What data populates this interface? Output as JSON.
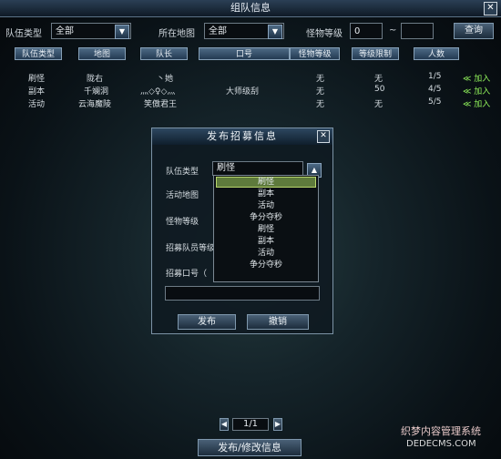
{
  "window": {
    "title": "组队信息",
    "close": "✕"
  },
  "filters": {
    "type_label": "队伍类型",
    "type_value": "全部",
    "map_label": "所在地图",
    "map_value": "全部",
    "level_label": "怪物等级",
    "level_min": "0",
    "level_sep": "~",
    "level_max": "",
    "search_button": "查询"
  },
  "columns": [
    "队伍类型",
    "地图",
    "队长",
    "口号",
    "怪物等级",
    "等级限制",
    "人数"
  ],
  "rows": [
    {
      "type": "刷怪",
      "map": "陇右",
      "leader": "丶她",
      "slogan": "",
      "monster_level": "无",
      "level_limit": "无",
      "count": "1/5",
      "join": "≪ 加入"
    },
    {
      "type": "副本",
      "map": "千斓洞",
      "leader": "灬◇♀◇灬",
      "slogan": "大师级刮",
      "monster_level": "无",
      "level_limit": "50",
      "count": "4/5",
      "join": "≪ 加入"
    },
    {
      "type": "活动",
      "map": "云海魔陵",
      "leader": "笑傲君王",
      "slogan": "",
      "monster_level": "无",
      "level_limit": "无",
      "count": "5/5",
      "join": "≪ 加入"
    }
  ],
  "modal": {
    "title": "发布招募信息",
    "close": "✕",
    "type_label": "队伍类型",
    "type_value": "刷怪",
    "map_label": "活动地图",
    "level_label": "怪物等级",
    "member_label": "招募队员等级",
    "slogan_label": "招募口号（",
    "options": [
      "刷怪",
      "副本",
      "活动",
      "争分夺秒",
      "刷怪",
      "副本",
      "活动",
      "争分夺秒"
    ],
    "publish_button": "发布",
    "cancel_button": "撤销"
  },
  "pager": {
    "page": "1/1"
  },
  "bottom_button": "发布/修改信息",
  "watermark": {
    "line1": "织梦内容管理系统",
    "line2": "DEDECMS.COM"
  },
  "colors": {
    "join": "#8ff05a",
    "accent": "#4d6a85"
  }
}
